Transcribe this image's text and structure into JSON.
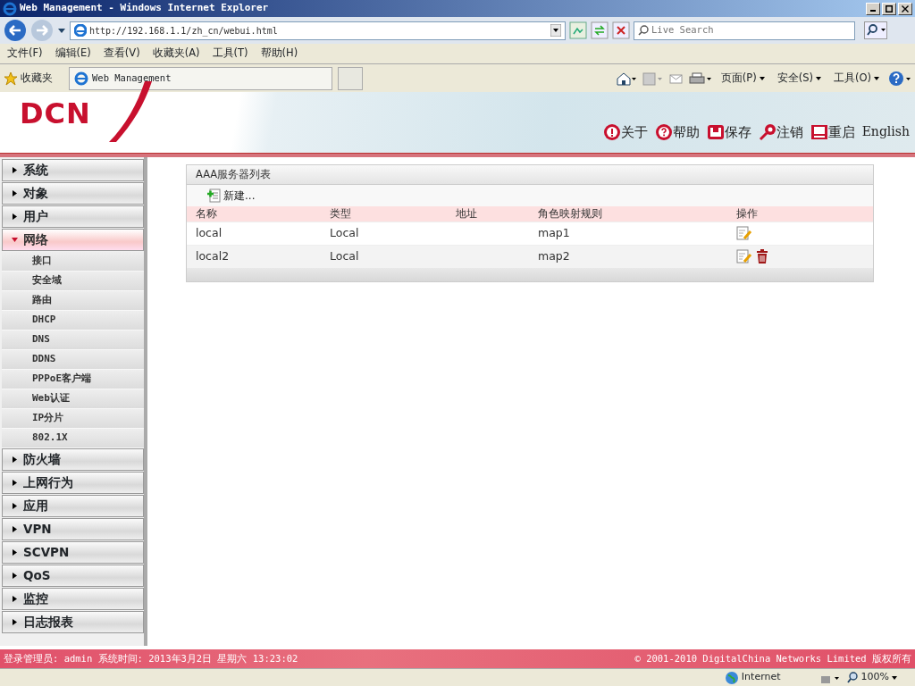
{
  "window": {
    "title": "Web Management - Windows Internet Explorer"
  },
  "browser": {
    "address": "http://192.168.1.1/zh_cn/webui.html",
    "search_placeholder": "Live Search",
    "menu": [
      "文件(F)",
      "编辑(E)",
      "查看(V)",
      "收藏夹(A)",
      "工具(T)",
      "帮助(H)"
    ],
    "favorites": "收藏夹",
    "tab": "Web Management",
    "commands": [
      "页面(P)",
      "安全(S)",
      "工具(O)"
    ]
  },
  "header": {
    "logo": "DCN",
    "actions": [
      {
        "kind": "about",
        "label": "关于"
      },
      {
        "kind": "help",
        "label": "帮助"
      },
      {
        "kind": "save",
        "label": "保存"
      },
      {
        "kind": "logout",
        "label": "注销"
      },
      {
        "kind": "reboot",
        "label": "重启"
      }
    ],
    "language": "English"
  },
  "sidebar": {
    "items": [
      {
        "label": "系统",
        "expanded": false
      },
      {
        "label": "对象",
        "expanded": false
      },
      {
        "label": "用户",
        "expanded": false
      },
      {
        "label": "网络",
        "expanded": true,
        "children": [
          {
            "label": "接口"
          },
          {
            "label": "安全域"
          },
          {
            "label": "路由"
          },
          {
            "label": "DHCP"
          },
          {
            "label": "DNS"
          },
          {
            "label": "DDNS"
          },
          {
            "label": "PPPoE客户端"
          },
          {
            "label": "Web认证"
          },
          {
            "label": "IP分片"
          },
          {
            "label": "802.1X"
          }
        ]
      },
      {
        "label": "防火墙",
        "expanded": false
      },
      {
        "label": "上网行为",
        "expanded": false
      },
      {
        "label": "应用",
        "expanded": false
      },
      {
        "label": "VPN",
        "expanded": false
      },
      {
        "label": "SCVPN",
        "expanded": false
      },
      {
        "label": "QoS",
        "expanded": false
      },
      {
        "label": "监控",
        "expanded": false
      },
      {
        "label": "日志报表",
        "expanded": false
      }
    ]
  },
  "panel": {
    "title": "AAA服务器列表",
    "new_button": "新建...",
    "table": {
      "columns": [
        "名称",
        "类型",
        "地址",
        "角色映射规则",
        "操作"
      ],
      "rows": [
        {
          "cells": [
            "local",
            "Local",
            "",
            "map1"
          ],
          "editable": true,
          "deletable": false
        },
        {
          "cells": [
            "local2",
            "Local",
            "",
            "map2"
          ],
          "editable": true,
          "deletable": true
        }
      ]
    }
  },
  "footer": {
    "left": "登录管理员: admin 系统时间: 2013年3月2日 星期六 13:23:02",
    "right": "© 2001-2010 DigitalChina Networks Limited 版权所有"
  },
  "status_bar": {
    "zone": "Internet",
    "zoom": "100%"
  }
}
